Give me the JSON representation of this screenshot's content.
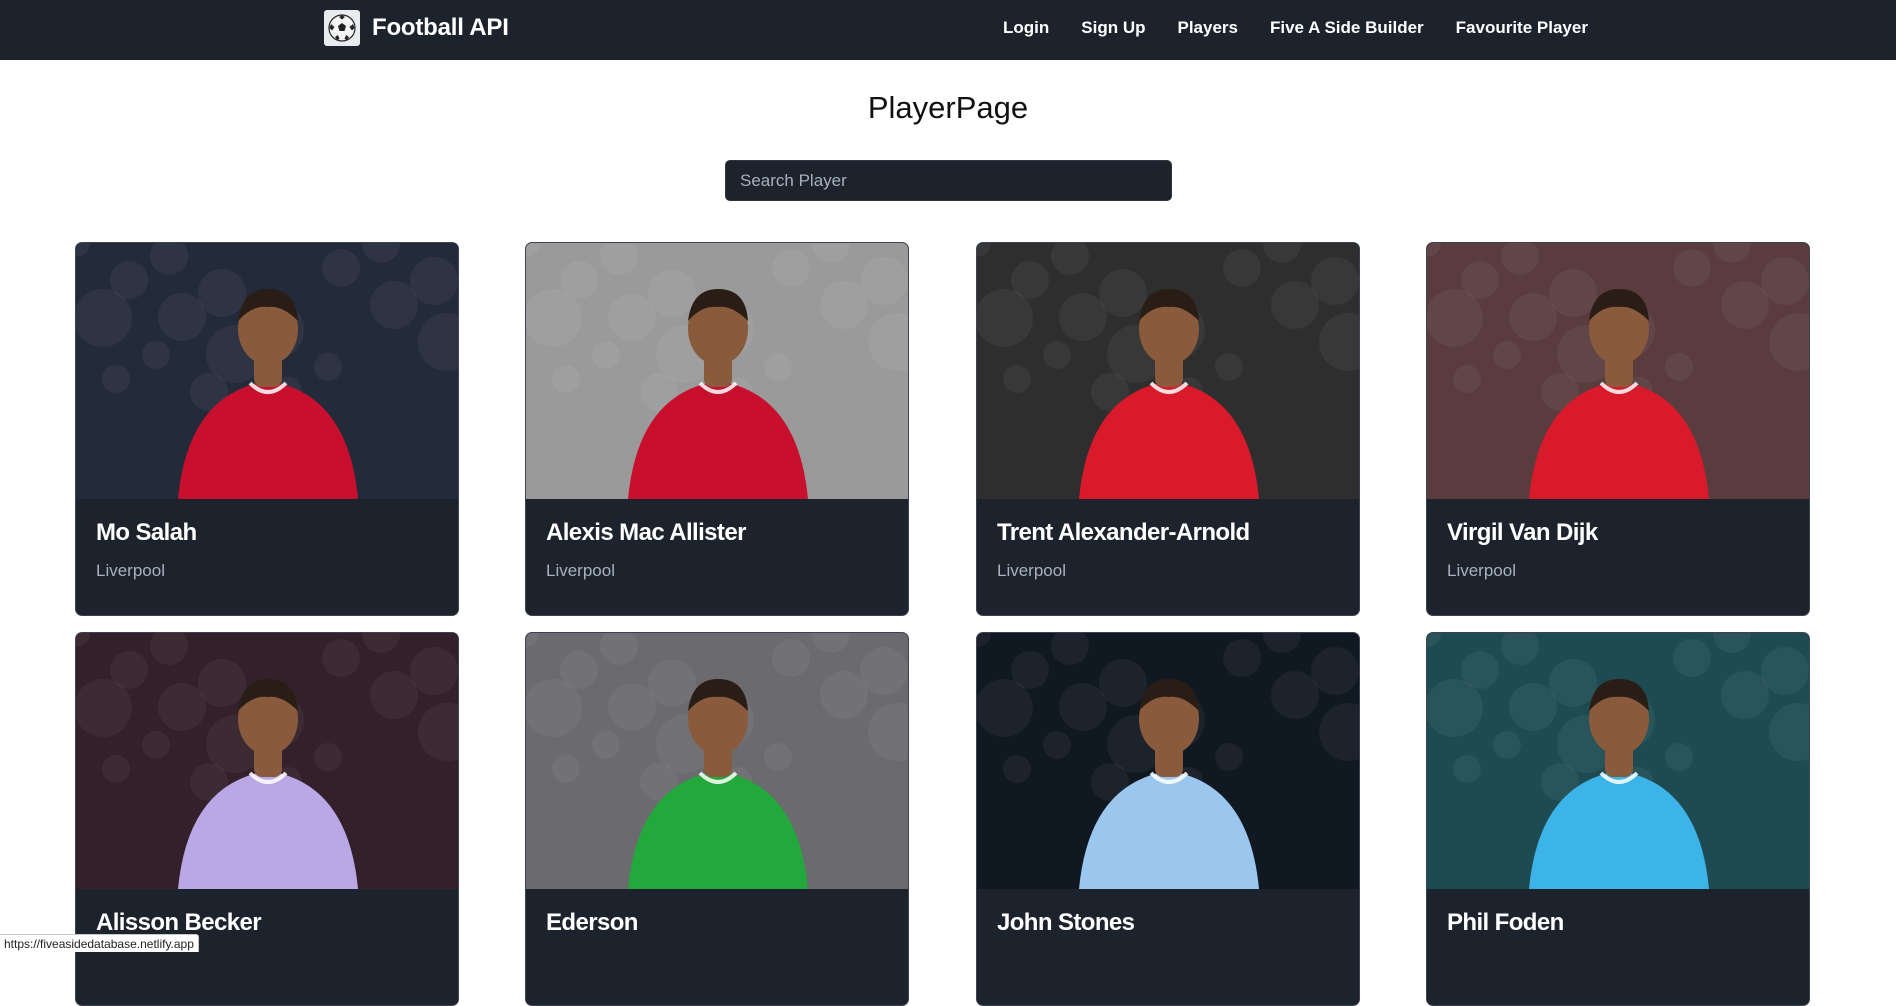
{
  "navbar": {
    "brand": "Football API",
    "links": [
      "Login",
      "Sign Up",
      "Players",
      "Five A Side Builder",
      "Favourite Player"
    ]
  },
  "page": {
    "title": "PlayerPage",
    "search_placeholder": "Search Player"
  },
  "players": [
    {
      "name": "Mo Salah",
      "club": "Liverpool",
      "kit": "#c8102e",
      "bg": "#232a3a"
    },
    {
      "name": "Alexis Mac Allister",
      "club": "Liverpool",
      "kit": "#c8102e",
      "bg": "#9a9a9a"
    },
    {
      "name": "Trent Alexander-Arnold",
      "club": "Liverpool",
      "kit": "#d81a2a",
      "bg": "#2e2e2e"
    },
    {
      "name": "Virgil Van Dijk",
      "club": "Liverpool",
      "kit": "#d81a2a",
      "bg": "#5a3b3e"
    },
    {
      "name": "Alisson Becker",
      "club": "",
      "kit": "#b9a7e6",
      "bg": "#33202a"
    },
    {
      "name": "Ederson",
      "club": "",
      "kit": "#22a83b",
      "bg": "#6b6a6e"
    },
    {
      "name": "John Stones",
      "club": "",
      "kit": "#9bc7ef",
      "bg": "#101822"
    },
    {
      "name": "Phil Foden",
      "club": "",
      "kit": "#3db4e8",
      "bg": "#1e4b52"
    }
  ],
  "status_bar": {
    "url": "https://fiveasidedatabase.netlify.app"
  }
}
